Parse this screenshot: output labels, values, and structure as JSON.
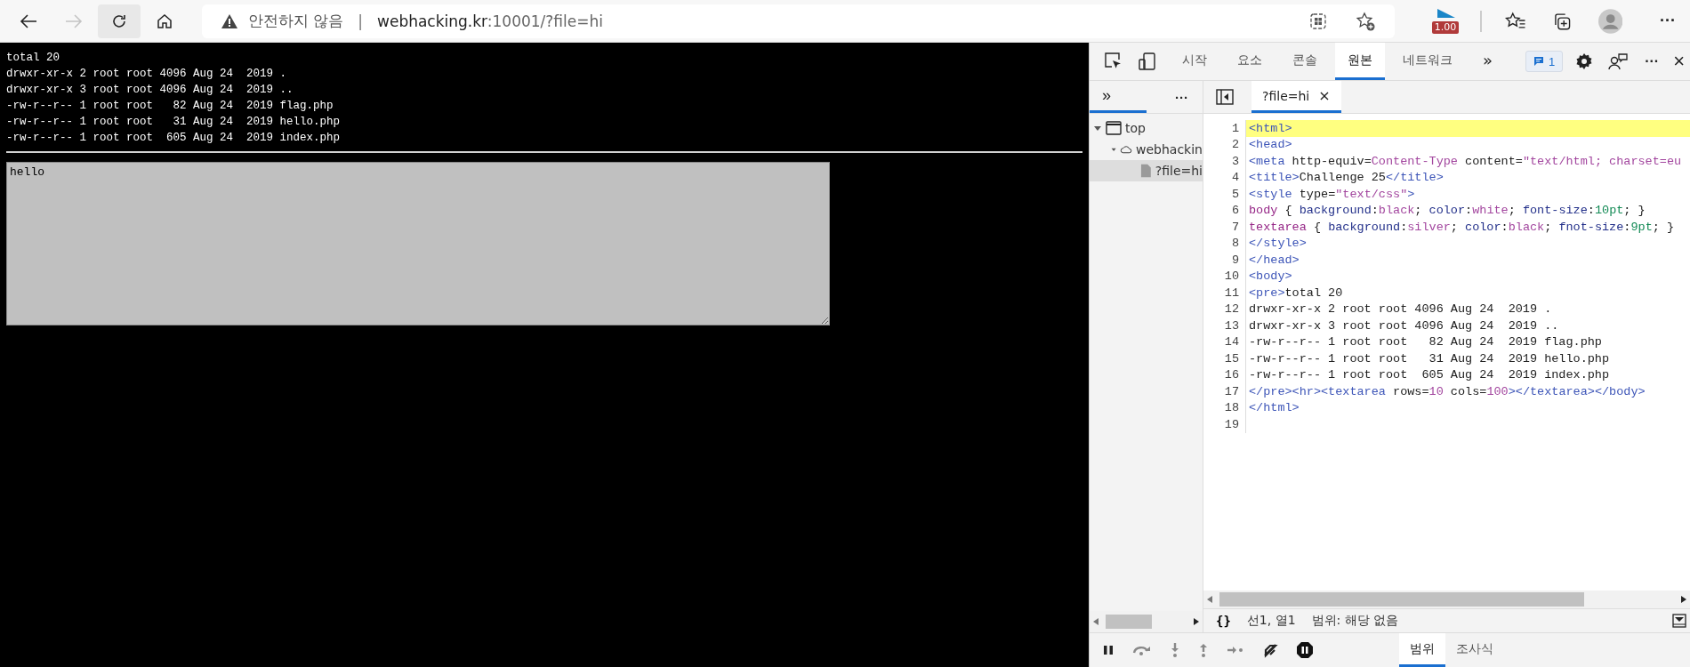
{
  "browser_toolbar": {
    "nav_buttons": [
      {
        "kind": "back",
        "disabled": false
      },
      {
        "kind": "forward",
        "disabled": true
      },
      {
        "kind": "refresh",
        "disabled": false
      },
      {
        "kind": "home",
        "disabled": false
      }
    ],
    "address": {
      "warning": "안전하지 않음",
      "separator": "|",
      "host": "webhacking.kr",
      "path": ":10001/?file=hi"
    },
    "extension_badge": "1.00",
    "more": "···"
  },
  "page": {
    "listing": [
      "total 20",
      "drwxr-xr-x 2 root root 4096 Aug 24  2019 .",
      "drwxr-xr-x 3 root root 4096 Aug 24  2019 ..",
      "-rw-r--r-- 1 root root   82 Aug 24  2019 flag.php",
      "-rw-r--r-- 1 root root   31 Aug 24  2019 hello.php",
      "-rw-r--r-- 1 root root  605 Aug 24  2019 index.php"
    ],
    "textarea": {
      "value": "hello"
    }
  },
  "devtools": {
    "tabs": [
      {
        "label": "시작",
        "selected": false
      },
      {
        "label": "요소",
        "selected": false
      },
      {
        "label": "콘솔",
        "selected": false
      },
      {
        "label": "원본",
        "selected": true
      },
      {
        "label": "네트워크",
        "selected": false
      }
    ],
    "overflow": "»",
    "issues_badge": "1",
    "more": "···",
    "close": "×",
    "navigator": {
      "tab": "»",
      "menu": "···",
      "tree": [
        {
          "label": "top",
          "kind": "frame",
          "expanded": true,
          "selected": false,
          "children": [
            {
              "label": "webhackin",
              "kind": "origin",
              "expanded": true,
              "selected": false,
              "children": [
                {
                  "label": "?file=hi",
                  "kind": "file",
                  "selected": true
                }
              ]
            }
          ]
        }
      ]
    },
    "editor_tabs": [
      {
        "label": "?file=hi",
        "selected": true,
        "close": "×"
      }
    ],
    "code_lines": [
      {
        "number": "1",
        "highlighted": true,
        "tokens": [
          {
            "kind": "tag",
            "text": "<html>"
          }
        ]
      },
      {
        "number": "2",
        "highlighted": false,
        "tokens": [
          {
            "kind": "tag",
            "text": "<head>"
          }
        ]
      },
      {
        "number": "3",
        "highlighted": false,
        "tokens": [
          {
            "kind": "tag",
            "text": "<meta "
          },
          {
            "kind": "attr",
            "text": "http-equiv"
          },
          {
            "kind": "text",
            "text": "="
          },
          {
            "kind": "value",
            "text": "Content-Type"
          },
          {
            "kind": "attr",
            "text": " content"
          },
          {
            "kind": "text",
            "text": "="
          },
          {
            "kind": "value",
            "text": "\"text/html; charset=eu"
          }
        ]
      },
      {
        "number": "4",
        "highlighted": false,
        "tokens": [
          {
            "kind": "tag",
            "text": "<title>"
          },
          {
            "kind": "text",
            "text": "Challenge 25"
          },
          {
            "kind": "tag",
            "text": "</title>"
          }
        ]
      },
      {
        "number": "5",
        "highlighted": false,
        "tokens": [
          {
            "kind": "tag",
            "text": "<style "
          },
          {
            "kind": "attr",
            "text": "type"
          },
          {
            "kind": "text",
            "text": "="
          },
          {
            "kind": "value",
            "text": "\"text/css\""
          },
          {
            "kind": "tag",
            "text": ">"
          }
        ]
      },
      {
        "number": "6",
        "highlighted": false,
        "tokens": [
          {
            "kind": "selector",
            "text": "body"
          },
          {
            "kind": "text",
            "text": " { "
          },
          {
            "kind": "property",
            "text": "background"
          },
          {
            "kind": "text",
            "text": ":"
          },
          {
            "kind": "value",
            "text": "black"
          },
          {
            "kind": "text",
            "text": "; "
          },
          {
            "kind": "property",
            "text": "color"
          },
          {
            "kind": "text",
            "text": ":"
          },
          {
            "kind": "value",
            "text": "white"
          },
          {
            "kind": "text",
            "text": "; "
          },
          {
            "kind": "property",
            "text": "font-size"
          },
          {
            "kind": "text",
            "text": ":"
          },
          {
            "kind": "number",
            "text": "10pt"
          },
          {
            "kind": "text",
            "text": "; }"
          }
        ]
      },
      {
        "number": "7",
        "highlighted": false,
        "tokens": [
          {
            "kind": "selector",
            "text": "textarea"
          },
          {
            "kind": "text",
            "text": " { "
          },
          {
            "kind": "property",
            "text": "background"
          },
          {
            "kind": "text",
            "text": ":"
          },
          {
            "kind": "value",
            "text": "silver"
          },
          {
            "kind": "text",
            "text": "; "
          },
          {
            "kind": "property",
            "text": "color"
          },
          {
            "kind": "text",
            "text": ":"
          },
          {
            "kind": "value",
            "text": "black"
          },
          {
            "kind": "text",
            "text": "; "
          },
          {
            "kind": "property",
            "text": "fnot-size"
          },
          {
            "kind": "text",
            "text": ":"
          },
          {
            "kind": "number",
            "text": "9pt"
          },
          {
            "kind": "text",
            "text": "; }"
          }
        ]
      },
      {
        "number": "8",
        "highlighted": false,
        "tokens": [
          {
            "kind": "tag",
            "text": "</style>"
          }
        ]
      },
      {
        "number": "9",
        "highlighted": false,
        "tokens": [
          {
            "kind": "tag",
            "text": "</head>"
          }
        ]
      },
      {
        "number": "10",
        "highlighted": false,
        "tokens": [
          {
            "kind": "tag",
            "text": "<body>"
          }
        ]
      },
      {
        "number": "11",
        "highlighted": false,
        "tokens": [
          {
            "kind": "tag",
            "text": "<pre>"
          },
          {
            "kind": "text",
            "text": "total 20"
          }
        ]
      },
      {
        "number": "12",
        "highlighted": false,
        "tokens": [
          {
            "kind": "text",
            "text": "drwxr-xr-x 2 root root 4096 Aug 24  2019 ."
          }
        ]
      },
      {
        "number": "13",
        "highlighted": false,
        "tokens": [
          {
            "kind": "text",
            "text": "drwxr-xr-x 3 root root 4096 Aug 24  2019 .."
          }
        ]
      },
      {
        "number": "14",
        "highlighted": false,
        "tokens": [
          {
            "kind": "text",
            "text": "-rw-r--r-- 1 root root   82 Aug 24  2019 flag.php"
          }
        ]
      },
      {
        "number": "15",
        "highlighted": false,
        "tokens": [
          {
            "kind": "text",
            "text": "-rw-r--r-- 1 root root   31 Aug 24  2019 hello.php"
          }
        ]
      },
      {
        "number": "16",
        "highlighted": false,
        "tokens": [
          {
            "kind": "text",
            "text": "-rw-r--r-- 1 root root  605 Aug 24  2019 index.php"
          }
        ]
      },
      {
        "number": "17",
        "highlighted": false,
        "tokens": [
          {
            "kind": "tag",
            "text": "</pre><hr><textarea "
          },
          {
            "kind": "attr",
            "text": "rows"
          },
          {
            "kind": "text",
            "text": "="
          },
          {
            "kind": "value",
            "text": "10"
          },
          {
            "kind": "attr",
            "text": " cols"
          },
          {
            "kind": "text",
            "text": "="
          },
          {
            "kind": "value",
            "text": "100"
          },
          {
            "kind": "tag",
            "text": "></textarea></body>"
          }
        ]
      },
      {
        "number": "18",
        "highlighted": false,
        "tokens": [
          {
            "kind": "tag",
            "text": "</html>"
          }
        ]
      },
      {
        "number": "19",
        "highlighted": false
      }
    ],
    "status": {
      "format": "{}",
      "cursor": "선1, 열1",
      "scope": "범위: 해당 없음"
    },
    "sidebar_tabs": [
      {
        "label": "범위",
        "selected": true
      },
      {
        "label": "조사식",
        "selected": false
      }
    ]
  }
}
